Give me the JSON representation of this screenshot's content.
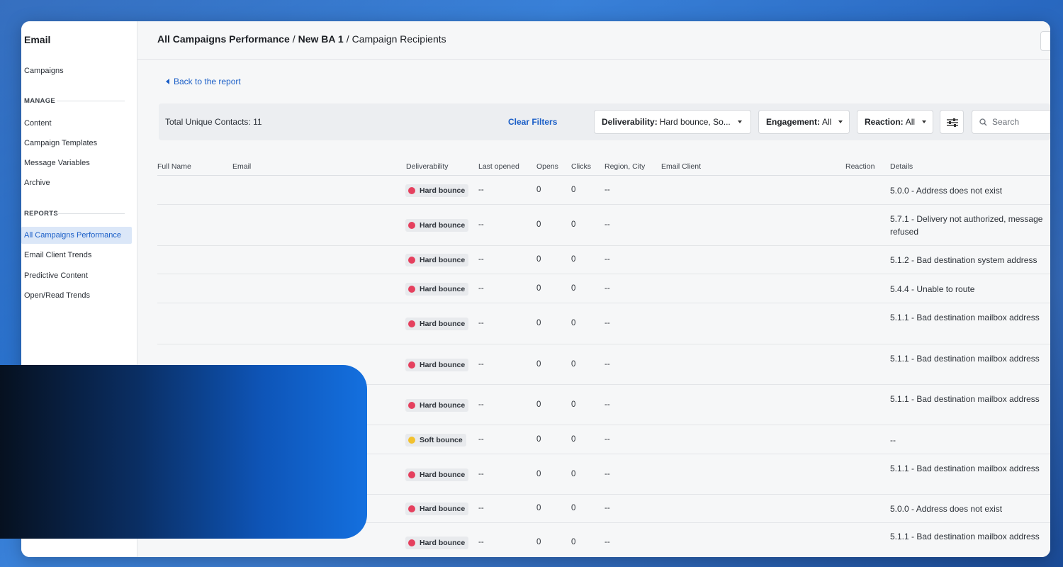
{
  "sidebar": {
    "title": "Email",
    "items": [
      {
        "label": "Campaigns"
      }
    ],
    "manage_section": "MANAGE",
    "manage_items": [
      {
        "label": "Content"
      },
      {
        "label": "Campaign Templates"
      },
      {
        "label": "Message Variables"
      },
      {
        "label": "Archive"
      }
    ],
    "reports_section": "REPORTS",
    "reports_items": [
      {
        "label": "All Campaigns Performance",
        "active": true
      },
      {
        "label": "Email Client Trends"
      },
      {
        "label": "Predictive Content"
      },
      {
        "label": "Open/Read Trends"
      }
    ]
  },
  "breadcrumb": {
    "part1": "All Campaigns Performance",
    "sep": "/",
    "part2": "New BA 1",
    "part3": "Campaign Recipients"
  },
  "back_link": "Back to the report",
  "filters": {
    "total": "Total Unique Contacts: 11",
    "clear": "Clear Filters",
    "deliverability_label": "Deliverability:",
    "deliverability_value": "Hard bounce, So...",
    "engagement_label": "Engagement:",
    "engagement_value": "All",
    "reaction_label": "Reaction:",
    "reaction_value": "All",
    "search_placeholder": "Search"
  },
  "columns": {
    "full_name": "Full Name",
    "email": "Email",
    "deliverability": "Deliverability",
    "last_opened": "Last opened",
    "opens": "Opens",
    "clicks": "Clicks",
    "region": "Region, City",
    "email_client": "Email Client",
    "reaction": "Reaction",
    "details": "Details"
  },
  "rows": [
    {
      "status": "Hard bounce",
      "last_opened": "--",
      "opens": "0",
      "clicks": "0",
      "region": "--",
      "details": "5.0.0 - Address does not exist"
    },
    {
      "status": "Hard bounce",
      "last_opened": "--",
      "opens": "0",
      "clicks": "0",
      "region": "--",
      "details": "5.7.1 - Delivery not authorized, message refused"
    },
    {
      "status": "Hard bounce",
      "last_opened": "--",
      "opens": "0",
      "clicks": "0",
      "region": "--",
      "details": "5.1.2 - Bad destination system address"
    },
    {
      "status": "Hard bounce",
      "last_opened": "--",
      "opens": "0",
      "clicks": "0",
      "region": "--",
      "details": "5.4.4 - Unable to route"
    },
    {
      "status": "Hard bounce",
      "last_opened": "--",
      "opens": "0",
      "clicks": "0",
      "region": "--",
      "details": "5.1.1 - Bad destination mailbox address"
    },
    {
      "status": "Hard bounce",
      "last_opened": "--",
      "opens": "0",
      "clicks": "0",
      "region": "--",
      "details": "5.1.1 - Bad destination mailbox address"
    },
    {
      "status": "Hard bounce",
      "last_opened": "--",
      "opens": "0",
      "clicks": "0",
      "region": "--",
      "details": "5.1.1 - Bad destination mailbox address"
    },
    {
      "status": "Soft bounce",
      "last_opened": "--",
      "opens": "0",
      "clicks": "0",
      "region": "--",
      "details": "--"
    },
    {
      "status": "Hard bounce",
      "last_opened": "--",
      "opens": "0",
      "clicks": "0",
      "region": "--",
      "details": "5.1.1 - Bad destination mailbox address"
    },
    {
      "status": "Hard bounce",
      "last_opened": "--",
      "opens": "0",
      "clicks": "0",
      "region": "--",
      "details": "5.0.0 - Address does not exist"
    },
    {
      "status": "Hard bounce",
      "last_opened": "--",
      "opens": "0",
      "clicks": "0",
      "region": "--",
      "details": "5.1.1 - Bad destination mailbox address"
    }
  ],
  "colors": {
    "hard_bounce": "#e5405e",
    "soft_bounce": "#f2c12e",
    "accent": "#1a5ec7"
  }
}
